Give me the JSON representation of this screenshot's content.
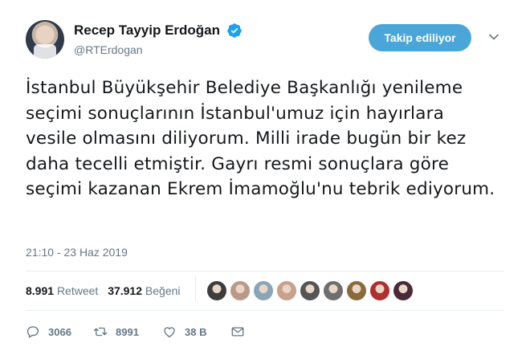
{
  "author": {
    "display_name": "Recep Tayyip Erdoğan",
    "handle": "@RTErdogan",
    "verified": true
  },
  "follow_button_label": "Takip ediliyor",
  "tweet": {
    "text": "İstanbul Büyükşehir Belediye Başkanlığı yenileme seçimi sonuçlarının İstanbul'umuz için hayırlara vesile olmasını diliyorum. Milli irade bugün bir kez daha tecelli etmiştir. Gayrı resmi sonuçlara göre seçimi kazanan Ekrem İmamoğlu'nu tebrik ediyorum.",
    "timestamp": "21:10 - 23 Haz 2019"
  },
  "stats": {
    "retweets_count": "8.991",
    "retweets_label": "Retweet",
    "likes_count": "37.912",
    "likes_label": "Beğeni"
  },
  "liker_avatar_colors": [
    "#3d3d3d",
    "#b89a86",
    "#8aa4b8",
    "#c9a08a",
    "#555555",
    "#6e6e6e",
    "#8a6a3a",
    "#b03030",
    "#4a2a3a"
  ],
  "actions": {
    "reply_count": "3066",
    "retweet_count": "8991",
    "like_count": "38 B"
  },
  "colors": {
    "accent": "#4aa6d8",
    "verified": "#1da1f2",
    "muted": "#657786"
  }
}
